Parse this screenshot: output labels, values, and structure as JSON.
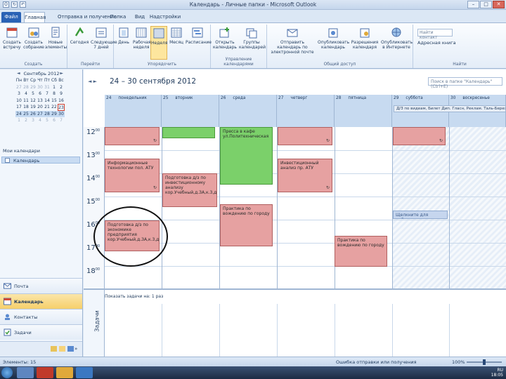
{
  "window": {
    "title": "Календарь - Личные папки - Microsoft Outlook",
    "controls": [
      "–",
      "□",
      "✕"
    ]
  },
  "tabs": [
    "Файл",
    "Главная",
    "Отправка и получение",
    "Папка",
    "Вид",
    "Надстройки"
  ],
  "ribbon": {
    "groups": [
      {
        "name": "Создать",
        "buttons": [
          "Создать встречу",
          "Создать собрание",
          "Новые элементы"
        ]
      },
      {
        "name": "Перейти",
        "buttons": [
          "Сегодня",
          "Следующие 7 дней"
        ]
      },
      {
        "name": "Упорядочить",
        "buttons": [
          "День",
          "Рабочая неделя",
          "Неделя",
          "Месяц",
          "Расписание"
        ]
      },
      {
        "name": "Управление календарями",
        "buttons": [
          "Открыть календарь",
          "Группы календарей"
        ]
      },
      {
        "name": "Общий доступ",
        "buttons": [
          "Отправить календарь по электронной почте",
          "Опубликовать календарь",
          "Разрешения календаря",
          "Опубликовать в Интернете"
        ]
      },
      {
        "name": "Найти",
        "buttons": []
      }
    ],
    "search_placeholder": "Найти контакт",
    "address_book": "Адресная книга"
  },
  "mini_calendar": {
    "month": "Сентябрь 2012",
    "weekdays": [
      "Пн",
      "Вт",
      "Ср",
      "Чт",
      "Пт",
      "Сб",
      "Вс"
    ],
    "weeks": [
      [
        "27",
        "28",
        "29",
        "30",
        "31",
        "1",
        "2"
      ],
      [
        "3",
        "4",
        "5",
        "6",
        "7",
        "8",
        "9"
      ],
      [
        "10",
        "11",
        "12",
        "13",
        "14",
        "15",
        "16"
      ],
      [
        "17",
        "18",
        "19",
        "20",
        "21",
        "22",
        "23"
      ],
      [
        "24",
        "25",
        "26",
        "27",
        "28",
        "29",
        "30"
      ],
      [
        "1",
        "2",
        "3",
        "4",
        "5",
        "6",
        "7"
      ]
    ]
  },
  "my_calendars_label": "Мои календари",
  "calendar_item": "Календарь",
  "nav": [
    "Почта",
    "Календарь",
    "Контакты",
    "Задачи"
  ],
  "calendar": {
    "range": "24 – 30 сентября 2012",
    "search_placeholder": "Поиск в папке \"Календарь\" (Ctrl+E)",
    "days": [
      {
        "num": "24",
        "name": "понедельник"
      },
      {
        "num": "25",
        "name": "вторник"
      },
      {
        "num": "26",
        "name": "среда"
      },
      {
        "num": "27",
        "name": "четверг"
      },
      {
        "num": "28",
        "name": "пятница"
      },
      {
        "num": "29",
        "name": "суббота"
      },
      {
        "num": "30",
        "name": "воскресенье"
      }
    ],
    "allday_event": "Д/З по видеам, Билет Дип. Гласн, Реклам. Таль-Березы 29/30",
    "hours": [
      "12",
      "13",
      "14",
      "15",
      "16",
      "17",
      "18"
    ],
    "events": [
      {
        "text": "Информационные технологии пол. АТУ",
        "color": "#e6a1a1"
      },
      {
        "text": "Подготовка д/з по инвестиционному анализу кор.Учебный,д.ЗА,к.3,д",
        "color": "#e6a1a1"
      },
      {
        "text": "Практика по вождению по городу",
        "color": "#e6a1a1"
      },
      {
        "text": "Инвестиционный анализ пр. АТУ",
        "color": "#e6a1a1"
      },
      {
        "text": "Практика по вождению по городу",
        "color": "#e6a1a1"
      },
      {
        "text": "Подготовка д/з по экономике предприятия кор.Учебный,д.ЗА,к.3,д",
        "color": "#e6a1a1"
      },
      {
        "text": "Пресса в кафе ул.Политехническая",
        "color": "#7bd06a"
      },
      {
        "text": "Щелкните для добавления",
        "color": "#c6d6ee"
      }
    ],
    "task_hint": "Показать задачи на: 1 раз",
    "task_label": "Задачи"
  },
  "status": {
    "items": "Элементы: 15",
    "error": "Ошибка отправки или получения",
    "zoom": "100%"
  },
  "taskbar": {
    "time": "18:05",
    "lang": "RU"
  }
}
